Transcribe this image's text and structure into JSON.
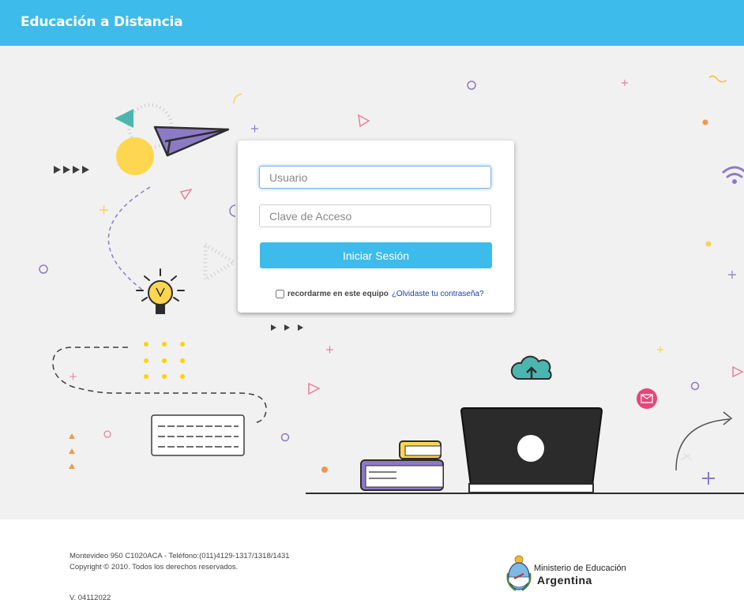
{
  "header": {
    "title": "Educación a Distancia"
  },
  "login": {
    "username_placeholder": "Usuario",
    "password_placeholder": "Clave de Acceso",
    "submit_label": "Iniciar Sesión",
    "remember_label": "recordarme en este equipo",
    "forgot_link": "¿Olvidaste tu contraseña?"
  },
  "footer": {
    "address": "Montevideo 950 C1020ACA - Teléfono:(011)4129-1317/1318/1431",
    "copyright": "Copyright © 2010. Todos los derechos reservados.",
    "version": "V. 04112022"
  },
  "brand": {
    "ministry": "Ministerio de Educación",
    "country": "Argentina"
  },
  "colors": {
    "header": "#3dbbea",
    "button": "#3dbbea",
    "hero_bg": "#f1f1f1",
    "link": "#1a3fa8",
    "laptop": "#2b2b2b",
    "accent_yellow": "#ffd64f",
    "accent_purple": "#8d7ac4",
    "accent_pink": "#e8457a",
    "accent_teal": "#4bb6b0"
  },
  "icons": [
    "paper-plane-icon",
    "lightbulb-icon",
    "wifi-icon",
    "cloud-upload-icon",
    "mail-icon",
    "laptop-icon",
    "books-icon",
    "keyboard-icon",
    "arrow-icon",
    "coat-of-arms-icon"
  ]
}
